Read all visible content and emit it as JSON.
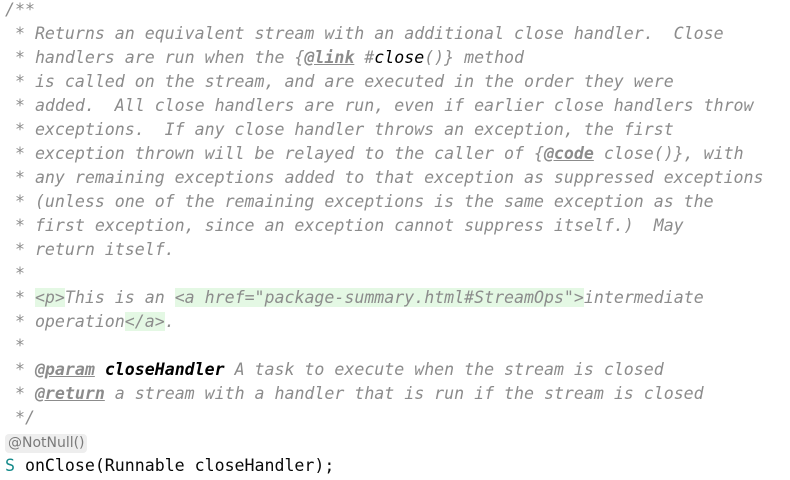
{
  "lines": [
    [
      {
        "s": "c",
        "t": "/**"
      }
    ],
    [
      {
        "s": "c",
        "t": " * Returns an equivalent stream with an additional close handler.  Close"
      }
    ],
    [
      {
        "s": "c",
        "t": " * handlers are run when the {"
      },
      {
        "s": "t",
        "t": "@link"
      },
      {
        "s": "c",
        "t": " #"
      },
      {
        "s": "k",
        "t": "close"
      },
      {
        "s": "c",
        "t": "()} method"
      }
    ],
    [
      {
        "s": "c",
        "t": " * is called on the stream, and are executed in the order they were"
      }
    ],
    [
      {
        "s": "c",
        "t": " * added.  All close handlers are run, even if earlier close handlers throw"
      }
    ],
    [
      {
        "s": "c",
        "t": " * exceptions.  If any close handler throws an exception, the first"
      }
    ],
    [
      {
        "s": "c",
        "t": " * exception thrown will be relayed to the caller of {"
      },
      {
        "s": "t",
        "t": "@code"
      },
      {
        "s": "c",
        "t": " close()}, with"
      }
    ],
    [
      {
        "s": "c",
        "t": " * any remaining exceptions added to that exception as suppressed exceptions"
      }
    ],
    [
      {
        "s": "c",
        "t": " * (unless one of the remaining exceptions is the same exception as the"
      }
    ],
    [
      {
        "s": "c",
        "t": " * first exception, since an exception cannot suppress itself.)  May"
      }
    ],
    [
      {
        "s": "c",
        "t": " * return itself."
      }
    ],
    [
      {
        "s": "c",
        "t": " *"
      }
    ],
    [
      {
        "s": "c",
        "t": " * "
      },
      {
        "s": "h",
        "t": "<p>"
      },
      {
        "s": "c",
        "t": "This is an "
      },
      {
        "s": "h",
        "t": "<a href=\"package-summary.html#StreamOps\">"
      },
      {
        "s": "c",
        "t": "intermediate"
      }
    ],
    [
      {
        "s": "c",
        "t": " * operation"
      },
      {
        "s": "h",
        "t": "</a>"
      },
      {
        "s": "c",
        "t": "."
      }
    ],
    [
      {
        "s": "c",
        "t": " *"
      }
    ],
    [
      {
        "s": "c",
        "t": " * "
      },
      {
        "s": "t",
        "t": "@param"
      },
      {
        "s": "c",
        "t": " "
      },
      {
        "s": "b",
        "t": "closeHandler"
      },
      {
        "s": "c",
        "t": " A task to execute when the stream is closed"
      }
    ],
    [
      {
        "s": "c",
        "t": " * "
      },
      {
        "s": "t",
        "t": "@return"
      },
      {
        "s": "c",
        "t": " a stream with a handler that is run if the stream is closed"
      }
    ],
    [
      {
        "s": "c",
        "t": " */"
      }
    ],
    [
      {
        "s": "hint",
        "t": "@NotNull()"
      }
    ],
    [
      {
        "s": "s",
        "t": "S"
      },
      {
        "s": "n",
        "t": " onClose(Runnable closeHandler);"
      }
    ]
  ]
}
